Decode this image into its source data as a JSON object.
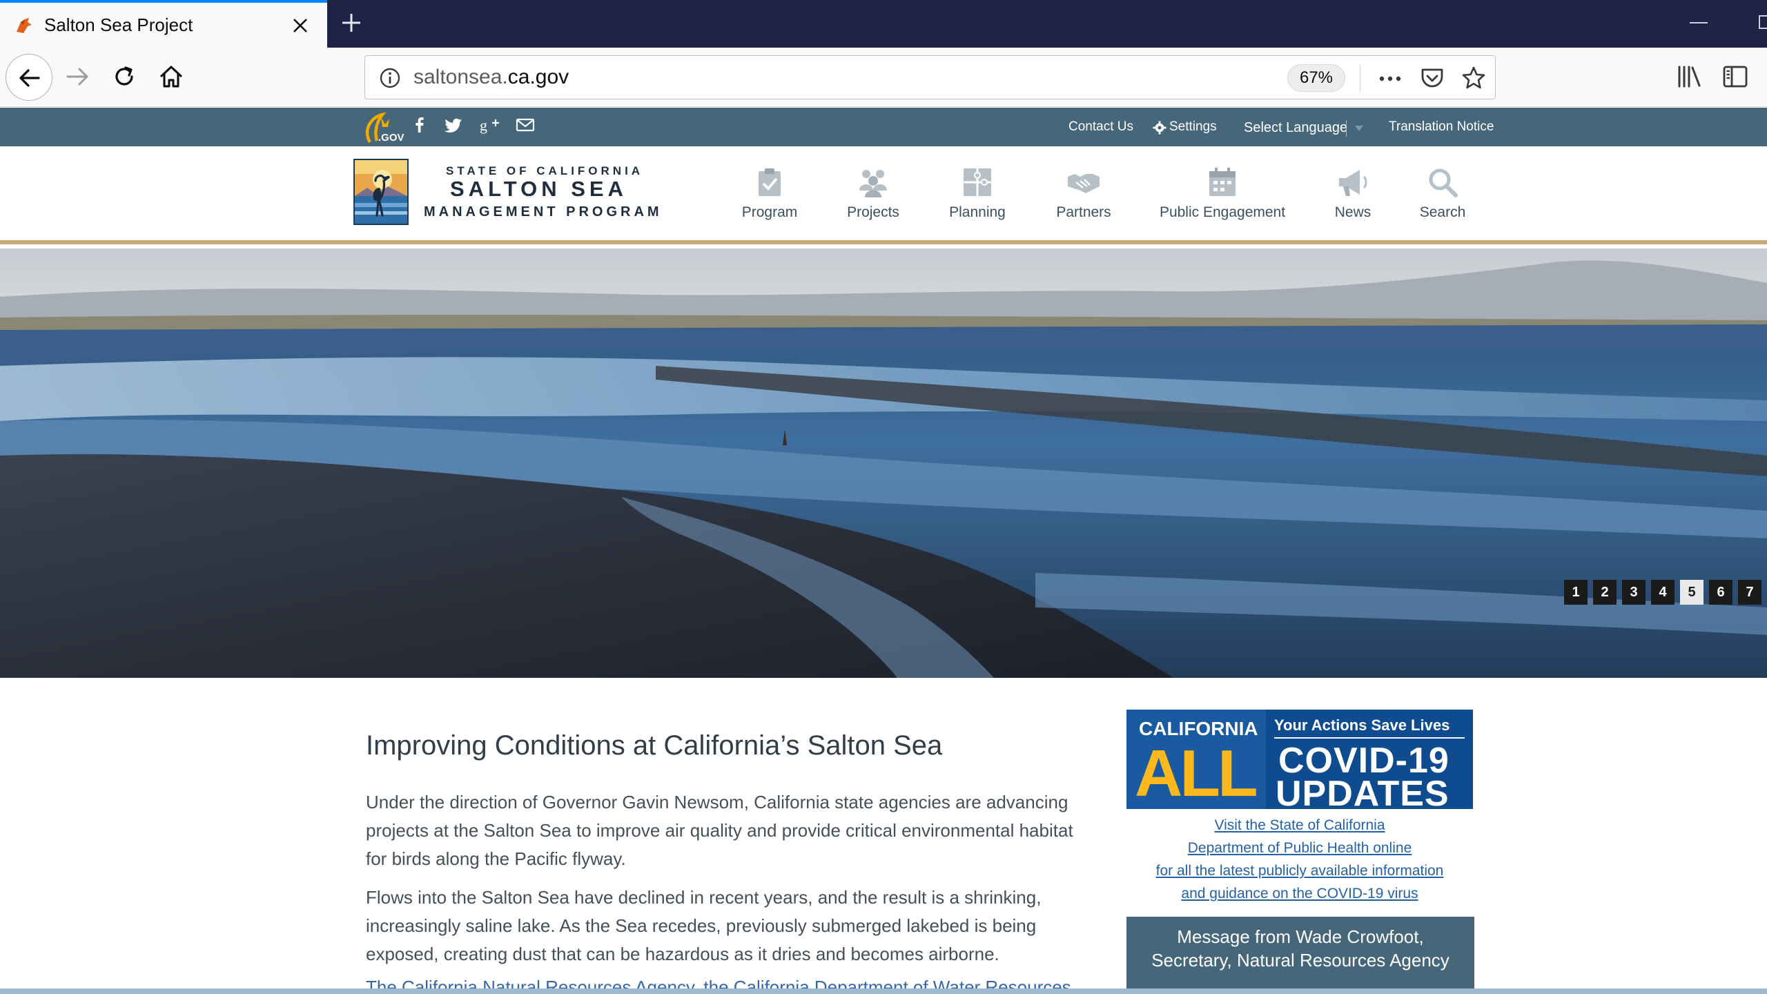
{
  "browser": {
    "tab_title": "Salton Sea Project",
    "url_prefix": "saltonsea.",
    "url_domain": "ca.gov",
    "zoom": "67%"
  },
  "utility_bar": {
    "contact": "Contact Us",
    "settings": "Settings",
    "language": "Select Language",
    "translation": "Translation Notice"
  },
  "header": {
    "org_line1": "STATE OF CALIFORNIA",
    "org_line2": "SALTON SEA",
    "org_line3": "MANAGEMENT PROGRAM",
    "nav": [
      {
        "label": "Program",
        "icon": "clipboard-check-icon"
      },
      {
        "label": "Projects",
        "icon": "people-group-icon"
      },
      {
        "label": "Planning",
        "icon": "puzzle-icon"
      },
      {
        "label": "Partners",
        "icon": "handshake-icon"
      },
      {
        "label": "Public Engagement",
        "icon": "calendar-icon"
      },
      {
        "label": "News",
        "icon": "megaphone-icon"
      },
      {
        "label": "Search",
        "icon": "magnifier-icon"
      }
    ]
  },
  "hero": {
    "slides": [
      "1",
      "2",
      "3",
      "4",
      "5",
      "6",
      "7"
    ],
    "active_slide": "5"
  },
  "main": {
    "title": "Improving Conditions at California’s Salton Sea",
    "para1": "Under the direction of Governor Gavin Newsom, California state agencies are advancing projects at the Salton Sea to improve air quality and provide critical environmental habitat for birds along the Pacific flyway.",
    "para2": "Flows into the Salton Sea have declined in recent years, and the result is a shrinking, increasingly saline lake. As the Sea recedes, previously submerged lakebed is being exposed, creating dust that can be hazardous as it dries and becomes airborne.",
    "para3": "The California Natural Resources Agency, the California Department of Water Resources"
  },
  "sidebar": {
    "covid_cal": "CALIFORNIA",
    "covid_all": "ALL",
    "covid_actions": "Your Actions Save Lives",
    "covid_updates1": "COVID-19",
    "covid_updates2": "UPDATES",
    "link1": "Visit the State of California",
    "link2": "Department of Public Health online",
    "link3": "for all the latest publicly available information",
    "link4": "and guidance on the COVID-19 virus",
    "message_line1": "Message from Wade Crowfoot,",
    "message_line2": "Secretary, Natural Resources Agency"
  },
  "colors": {
    "chrome_dark": "#1f2346",
    "utility_bar": "#46667a",
    "header_accent": "#c9a97a",
    "covid_blue": "#0f4c8f",
    "covid_gold": "#fdb81e",
    "link": "#2462a6"
  }
}
